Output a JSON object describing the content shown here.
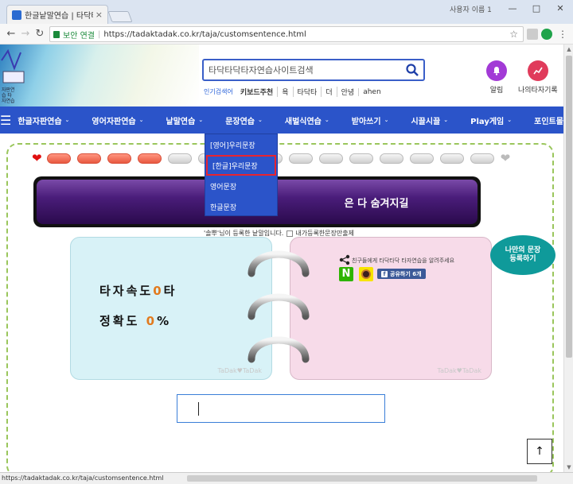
{
  "browser": {
    "tab_title": "한글낱말연습 | 타닥타닥",
    "tab_close": "×",
    "window_user": "사용자 이름 1",
    "minimize": "—",
    "maximize": "□",
    "close": "✕",
    "back": "←",
    "forward": "→",
    "reload": "↻",
    "secure_label": "보안 연결",
    "separator": "|",
    "url": "https://tadaktadak.co.kr/taja/customsentence.html",
    "bookmark_star": "☆"
  },
  "header": {
    "logo_text": "자판연습 타자연습",
    "search_placeholder": "타닥타닥타자연습사이트검색",
    "popular_label": "인기검색어",
    "quick_links": [
      "키보드주천",
      "욕",
      "타닥타",
      "더",
      "안녕",
      "ahen"
    ],
    "alarm_label": "알림",
    "record_label": "나의타자기록",
    "alarm_color": "#a23ad6",
    "record_color": "#e03b5b"
  },
  "nav": {
    "menu_icon": "☰",
    "items": [
      "한글자판연습",
      "영어자판연습",
      "낱말연습",
      "문장연습",
      "새벌식연습",
      "받아쓰기",
      "시끌시끌",
      "Play게임",
      "포인트몰"
    ],
    "chevron": "⌄",
    "accent": "#2b54c9"
  },
  "dropdown": {
    "items": [
      "[영어]우리문장",
      "[한글]우리문장",
      "영어문장",
      "한글문장"
    ],
    "selected_index": 1
  },
  "progress": {
    "filled": 4,
    "total": 15,
    "heart_full": "❤",
    "heart_empty": "❤"
  },
  "display": {
    "text": "은 다 숨겨지길"
  },
  "registered": {
    "text": "'솔뿌'님이 등록한 낱말입니다.",
    "checkbox_label": "내가등록한문장만출제"
  },
  "stats": {
    "speed_label": "타자속도",
    "speed_value": "0",
    "speed_unit": "타",
    "accuracy_label": "정확도",
    "accuracy_value": "0",
    "accuracy_unit": "%",
    "watermark": "TaDak♥TaDak"
  },
  "share": {
    "text": "친구들에게 타닥타닥 타자연습을 알려주세요",
    "naver": "N",
    "facebook_label": "공유하기 6개",
    "fb_glyph": "f"
  },
  "bubble": {
    "line1": "나만의 문장",
    "line2": "등록하기"
  },
  "to_top": "↑",
  "status_url": "https://tadaktadak.co.kr/taja/customsentence.html"
}
